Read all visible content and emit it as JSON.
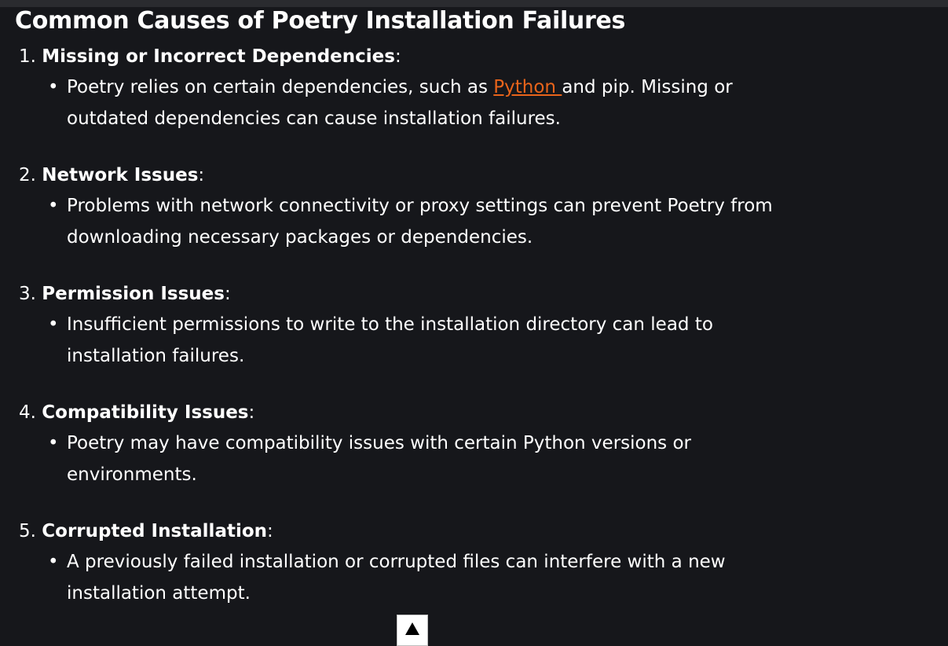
{
  "article": {
    "heading": "Common Causes of Poetry Installation Failures",
    "causes": [
      {
        "number": "1.",
        "title": "Missing or Incorrect Dependencies",
        "suffix": ":",
        "detail_before": "Poetry relies on certain dependencies, such as ",
        "link_text": "Python ",
        "detail_after": "and pip. Missing or outdated dependencies can cause installation failures."
      },
      {
        "number": "2.",
        "title": "Network Issues",
        "suffix": ":",
        "detail": "Problems with network connectivity or proxy settings can prevent Poetry from downloading necessary packages or dependencies."
      },
      {
        "number": "3.",
        "title": "Permission Issues",
        "suffix": ":",
        "detail": "Insufficient permissions to write to the installation directory can lead to installation failures."
      },
      {
        "number": "4.",
        "title": "Compatibility Issues",
        "suffix": ":",
        "detail": "Poetry may have compatibility issues with certain Python versions or environments."
      },
      {
        "number": "5.",
        "title": "Corrupted Installation",
        "suffix": ":",
        "detail": "A previously failed installation or corrupted files can interfere with a new installation attempt."
      }
    ],
    "bullet_glyph": "•"
  },
  "colors": {
    "background": "#16171b",
    "text": "#ffffff",
    "link": "#e8641b"
  },
  "icons": {
    "scroll_top": "arrow-up-icon"
  }
}
